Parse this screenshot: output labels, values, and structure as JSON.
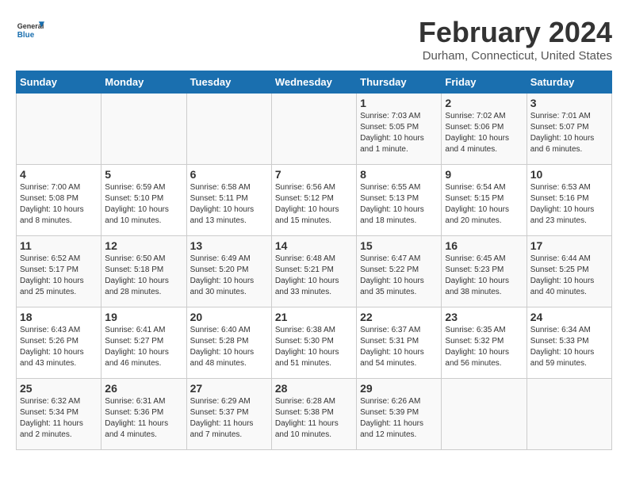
{
  "header": {
    "logo": {
      "general": "General",
      "blue": "Blue"
    },
    "title": "February 2024",
    "subtitle": "Durham, Connecticut, United States"
  },
  "columns": [
    "Sunday",
    "Monday",
    "Tuesday",
    "Wednesday",
    "Thursday",
    "Friday",
    "Saturday"
  ],
  "weeks": [
    [
      {
        "day": "",
        "info": ""
      },
      {
        "day": "",
        "info": ""
      },
      {
        "day": "",
        "info": ""
      },
      {
        "day": "",
        "info": ""
      },
      {
        "day": "1",
        "info": "Sunrise: 7:03 AM\nSunset: 5:05 PM\nDaylight: 10 hours and 1 minute."
      },
      {
        "day": "2",
        "info": "Sunrise: 7:02 AM\nSunset: 5:06 PM\nDaylight: 10 hours and 4 minutes."
      },
      {
        "day": "3",
        "info": "Sunrise: 7:01 AM\nSunset: 5:07 PM\nDaylight: 10 hours and 6 minutes."
      }
    ],
    [
      {
        "day": "4",
        "info": "Sunrise: 7:00 AM\nSunset: 5:08 PM\nDaylight: 10 hours and 8 minutes."
      },
      {
        "day": "5",
        "info": "Sunrise: 6:59 AM\nSunset: 5:10 PM\nDaylight: 10 hours and 10 minutes."
      },
      {
        "day": "6",
        "info": "Sunrise: 6:58 AM\nSunset: 5:11 PM\nDaylight: 10 hours and 13 minutes."
      },
      {
        "day": "7",
        "info": "Sunrise: 6:56 AM\nSunset: 5:12 PM\nDaylight: 10 hours and 15 minutes."
      },
      {
        "day": "8",
        "info": "Sunrise: 6:55 AM\nSunset: 5:13 PM\nDaylight: 10 hours and 18 minutes."
      },
      {
        "day": "9",
        "info": "Sunrise: 6:54 AM\nSunset: 5:15 PM\nDaylight: 10 hours and 20 minutes."
      },
      {
        "day": "10",
        "info": "Sunrise: 6:53 AM\nSunset: 5:16 PM\nDaylight: 10 hours and 23 minutes."
      }
    ],
    [
      {
        "day": "11",
        "info": "Sunrise: 6:52 AM\nSunset: 5:17 PM\nDaylight: 10 hours and 25 minutes."
      },
      {
        "day": "12",
        "info": "Sunrise: 6:50 AM\nSunset: 5:18 PM\nDaylight: 10 hours and 28 minutes."
      },
      {
        "day": "13",
        "info": "Sunrise: 6:49 AM\nSunset: 5:20 PM\nDaylight: 10 hours and 30 minutes."
      },
      {
        "day": "14",
        "info": "Sunrise: 6:48 AM\nSunset: 5:21 PM\nDaylight: 10 hours and 33 minutes."
      },
      {
        "day": "15",
        "info": "Sunrise: 6:47 AM\nSunset: 5:22 PM\nDaylight: 10 hours and 35 minutes."
      },
      {
        "day": "16",
        "info": "Sunrise: 6:45 AM\nSunset: 5:23 PM\nDaylight: 10 hours and 38 minutes."
      },
      {
        "day": "17",
        "info": "Sunrise: 6:44 AM\nSunset: 5:25 PM\nDaylight: 10 hours and 40 minutes."
      }
    ],
    [
      {
        "day": "18",
        "info": "Sunrise: 6:43 AM\nSunset: 5:26 PM\nDaylight: 10 hours and 43 minutes."
      },
      {
        "day": "19",
        "info": "Sunrise: 6:41 AM\nSunset: 5:27 PM\nDaylight: 10 hours and 46 minutes."
      },
      {
        "day": "20",
        "info": "Sunrise: 6:40 AM\nSunset: 5:28 PM\nDaylight: 10 hours and 48 minutes."
      },
      {
        "day": "21",
        "info": "Sunrise: 6:38 AM\nSunset: 5:30 PM\nDaylight: 10 hours and 51 minutes."
      },
      {
        "day": "22",
        "info": "Sunrise: 6:37 AM\nSunset: 5:31 PM\nDaylight: 10 hours and 54 minutes."
      },
      {
        "day": "23",
        "info": "Sunrise: 6:35 AM\nSunset: 5:32 PM\nDaylight: 10 hours and 56 minutes."
      },
      {
        "day": "24",
        "info": "Sunrise: 6:34 AM\nSunset: 5:33 PM\nDaylight: 10 hours and 59 minutes."
      }
    ],
    [
      {
        "day": "25",
        "info": "Sunrise: 6:32 AM\nSunset: 5:34 PM\nDaylight: 11 hours and 2 minutes."
      },
      {
        "day": "26",
        "info": "Sunrise: 6:31 AM\nSunset: 5:36 PM\nDaylight: 11 hours and 4 minutes."
      },
      {
        "day": "27",
        "info": "Sunrise: 6:29 AM\nSunset: 5:37 PM\nDaylight: 11 hours and 7 minutes."
      },
      {
        "day": "28",
        "info": "Sunrise: 6:28 AM\nSunset: 5:38 PM\nDaylight: 11 hours and 10 minutes."
      },
      {
        "day": "29",
        "info": "Sunrise: 6:26 AM\nSunset: 5:39 PM\nDaylight: 11 hours and 12 minutes."
      },
      {
        "day": "",
        "info": ""
      },
      {
        "day": "",
        "info": ""
      }
    ]
  ]
}
